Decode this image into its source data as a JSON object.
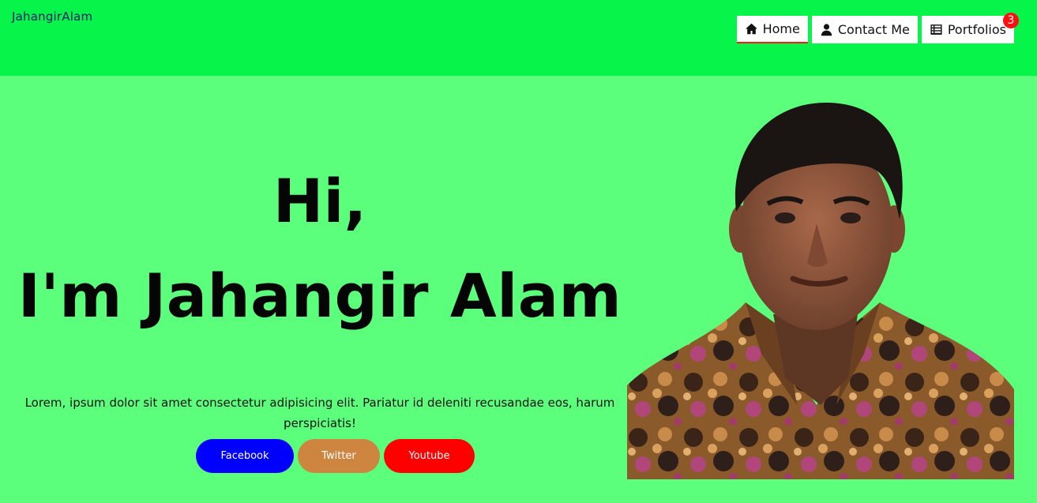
{
  "navbar": {
    "brand": "JahangirAlam",
    "items": [
      {
        "label": "Home",
        "icon": "home-icon"
      },
      {
        "label": "Contact Me",
        "icon": "user-icon"
      },
      {
        "label": "Portfolios",
        "icon": "list-icon",
        "badge": "3"
      }
    ]
  },
  "hero": {
    "greeting": "Hi,",
    "name": "I'm Jahangir Alam",
    "intro": "Lorem, ipsum dolor sit amet consectetur adipisicing elit. Pariatur id deleniti recusandae eos, harum perspiciatis!",
    "buttons": [
      {
        "label": "Facebook",
        "color": "#0000ff"
      },
      {
        "label": "Twitter",
        "color": "#cd853f"
      },
      {
        "label": "Youtube",
        "color": "#ff0000"
      }
    ]
  },
  "colors": {
    "navbar_bg": "#07f54a",
    "page_bg": "#5cff7c",
    "active_underline": "#ff1a1a",
    "badge": "#ff1010"
  }
}
